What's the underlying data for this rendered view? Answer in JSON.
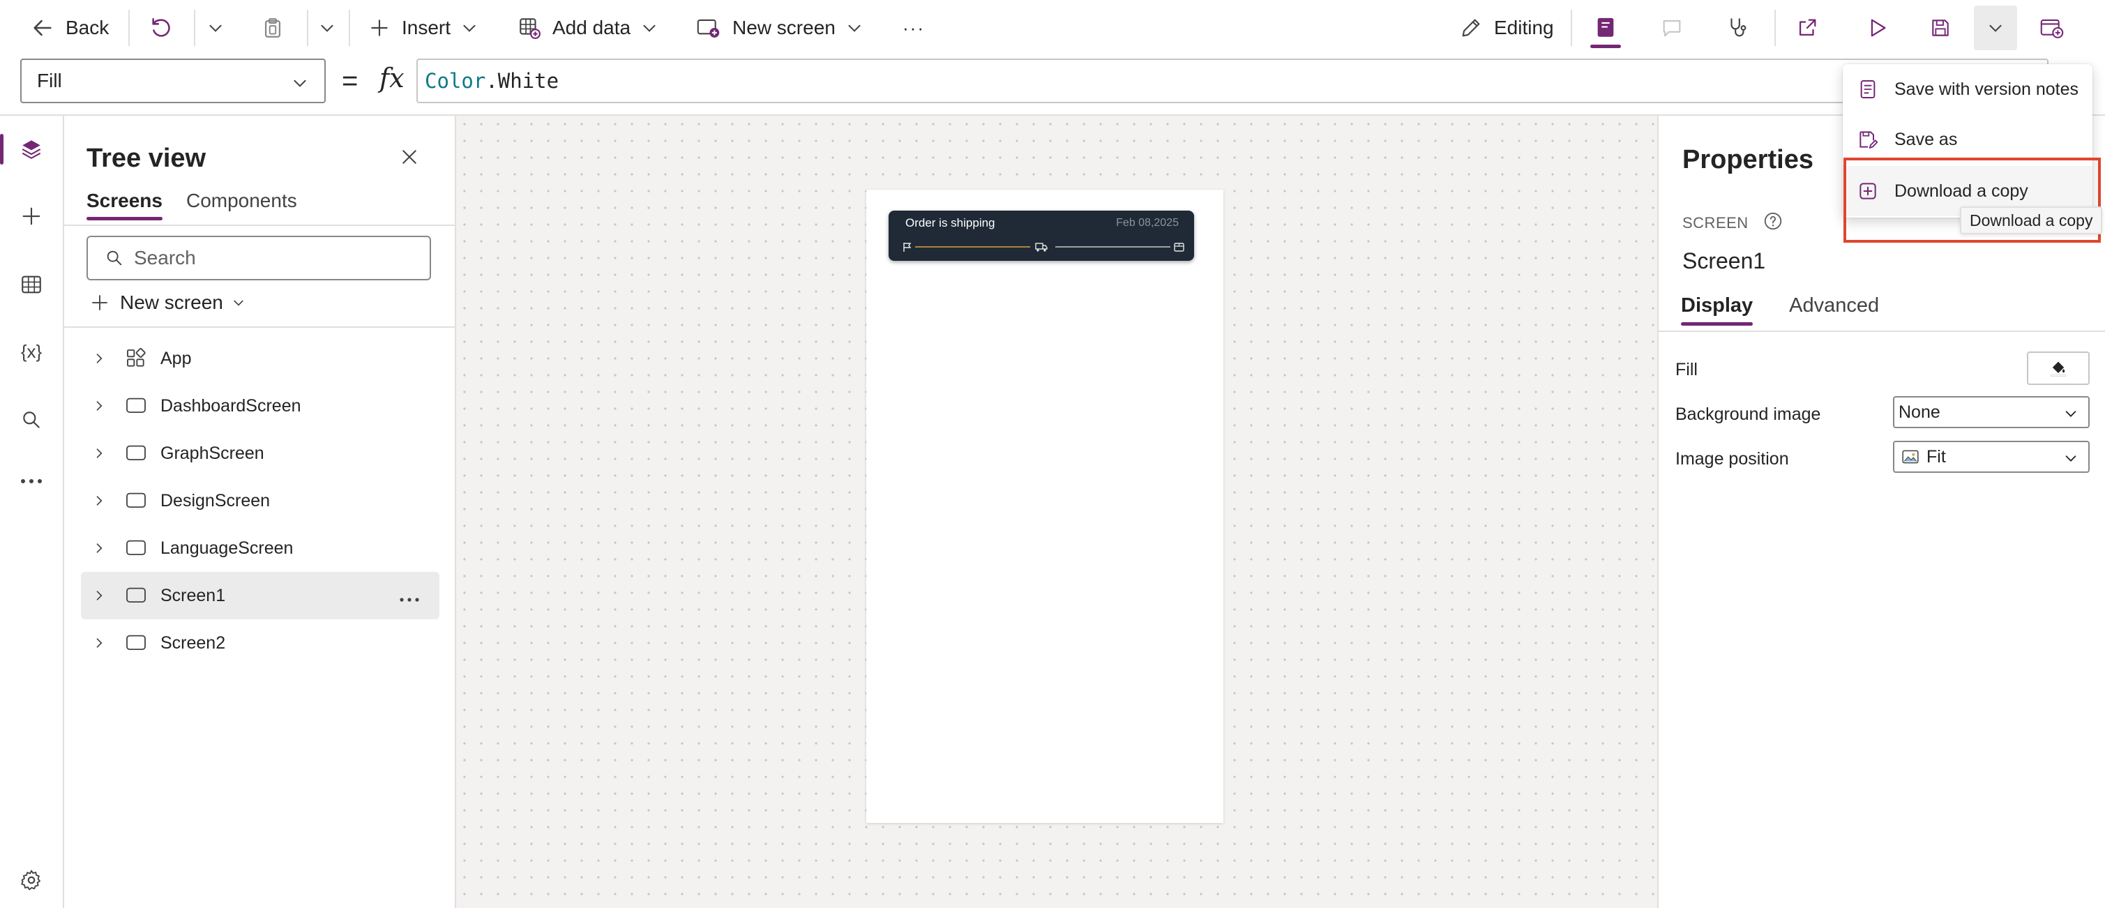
{
  "toolbar": {
    "back_label": "Back",
    "insert_label": "Insert",
    "add_data_label": "Add data",
    "new_screen_label": "New screen",
    "more_label": "···",
    "editing_label": "Editing"
  },
  "formula_bar": {
    "property": "Fill",
    "equals": "=",
    "fx": "fx",
    "formula_object": "Color",
    "formula_dot": ".",
    "formula_member": "White"
  },
  "tree_view": {
    "title": "Tree view",
    "tabs": [
      "Screens",
      "Components"
    ],
    "selected_tab": "Screens",
    "search_placeholder": "Search",
    "new_screen_label": "New screen",
    "items": [
      {
        "name": "App",
        "icon": "app-icon",
        "selected": false
      },
      {
        "name": "DashboardScreen",
        "icon": "screen-icon",
        "selected": false
      },
      {
        "name": "GraphScreen",
        "icon": "screen-icon",
        "selected": false
      },
      {
        "name": "DesignScreen",
        "icon": "screen-icon",
        "selected": false
      },
      {
        "name": "LanguageScreen",
        "icon": "screen-icon",
        "selected": false
      },
      {
        "name": "Screen1",
        "icon": "screen-icon",
        "selected": true
      },
      {
        "name": "Screen2",
        "icon": "screen-icon",
        "selected": false
      }
    ]
  },
  "canvas": {
    "card_title": "Order is shipping",
    "card_date": "Feb 08,2025",
    "shipping_progress": 0.5
  },
  "properties": {
    "title": "Properties",
    "kind": "SCREEN",
    "screen_name": "Screen1",
    "tabs": [
      "Display",
      "Advanced"
    ],
    "selected_tab": "Display",
    "fill_label": "Fill",
    "background_image_label": "Background image",
    "background_image_value": "None",
    "image_position_label": "Image position",
    "image_position_value": "Fit"
  },
  "save_menu": {
    "items": [
      {
        "label": "Save with version notes",
        "icon": "notes-icon"
      },
      {
        "label": "Save as",
        "icon": "save-as-icon"
      },
      {
        "label": "Download a copy",
        "icon": "download-copy-icon"
      }
    ],
    "tooltip": "Download a copy"
  },
  "colors": {
    "accent": "#742774",
    "highlight": "#e0452e",
    "card_bg": "#1f2a36",
    "track_active": "#d9a441"
  }
}
